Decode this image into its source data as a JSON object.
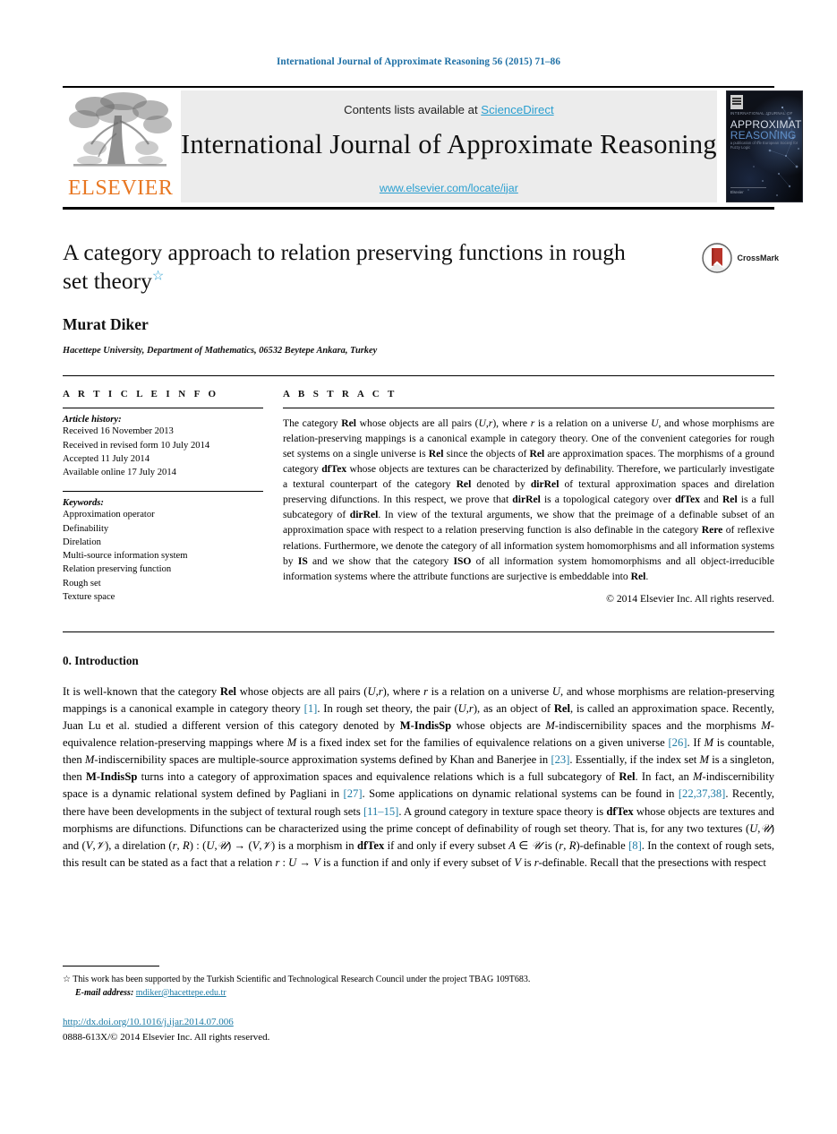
{
  "running_head": "International Journal of Approximate Reasoning 56 (2015) 71–86",
  "masthead": {
    "contents_prefix": "Contents lists available at ",
    "sciencedirect": "ScienceDirect",
    "journal_title": "International Journal of Approximate Reasoning",
    "journal_url": "www.elsevier.com/locate/ijar",
    "publisher": "ELSEVIER",
    "cover": {
      "line_small": "INTERNATIONAL JOURNAL OF",
      "line1": "APPROXIMATE",
      "line2": "REASONING",
      "line3": "a publication of the European Society for Fuzzy Logic",
      "foot": "Elsevier"
    }
  },
  "article": {
    "title": "A category approach to relation preserving functions in rough set theory",
    "title_marker": "☆",
    "author": "Murat Diker",
    "affiliation": "Hacettepe University, Department of Mathematics, 06532 Beytepe Ankara, Turkey",
    "crossmark_label": "CrossMark"
  },
  "info": {
    "heading": "A R T I C L E   I N F O",
    "history_label": "Article history:",
    "history": [
      "Received 16 November 2013",
      "Received in revised form 10 July 2014",
      "Accepted 11 July 2014",
      "Available online 17 July 2014"
    ],
    "keywords_label": "Keywords:",
    "keywords": [
      "Approximation operator",
      "Definability",
      "Direlation",
      "Multi-source information system",
      "Relation preserving function",
      "Rough set",
      "Texture space"
    ]
  },
  "abstract": {
    "heading": "A B S T R A C T",
    "text_html": "The category <b>Rel</b> whose objects are all pairs (<i>U</i>,<i>r</i>), where <i>r</i> is a relation on a universe <i>U</i>, and whose morphisms are relation-preserving mappings is a canonical example in category theory. One of the convenient categories for rough set systems on a single universe is <b>Rel</b> since the objects of <b>Rel</b> are approximation spaces. The morphisms of a ground category <b>dfTex</b> whose objects are textures can be characterized by definability. Therefore, we particularly investigate a textural counterpart of the category <b>Rel</b> denoted by <b>dirRel</b> of textural approximation spaces and direlation preserving difunctions. In this respect, we prove that <b>dirRel</b> is a topological category over <b>dfTex</b> and <b>Rel</b> is a full subcategory of <b>dirRel</b>. In view of the textural arguments, we show that the preimage of a definable subset of an approximation space with respect to a relation preserving function is also definable in the category <b>Rere</b> of reflexive relations. Furthermore, we denote the category of all information system homomorphisms and all information systems by <b>IS</b> and we show that the category <b>ISO</b> of all information system homomorphisms and all object-irreducible information systems where the attribute functions are surjective is embeddable into <b>Rel</b>.",
    "copyright": "© 2014 Elsevier Inc. All rights reserved."
  },
  "section": {
    "number": "0.",
    "heading": "0.  Introduction",
    "paragraph_html": "It is well-known that the category <b>Rel</b> whose objects are all pairs (<i>U</i>,<i>r</i>), where <i>r</i> is a relation on a universe <i>U</i>, and whose morphisms are relation-preserving mappings is a canonical example in category theory <span class=\"ref\">[1]</span>. In rough set theory, the pair (<i>U</i>,<i>r</i>), as an object of <b>Rel</b>, is called an approximation space. Recently, Juan Lu et al. studied a different version of this category denoted by <b>M-IndisSp</b> whose objects are <i>M</i>-indiscernibility spaces and the morphisms <i>M</i>-equivalence relation-preserving mappings where <i>M</i> is a fixed index set for the families of equivalence relations on a given universe <span class=\"ref\">[26]</span>. If <i>M</i> is countable, then <i>M</i>-indiscernibility spaces are multiple-source approximation systems defined by Khan and Banerjee in <span class=\"ref\">[23]</span>. Essentially, if the index set <i>M</i> is a singleton, then <b>M-IndisSp</b> turns into a category of approximation spaces and equivalence relations which is a full subcategory of <b>Rel</b>. In fact, an <i>M</i>-indiscernibility space is a dynamic relational system defined by Pagliani in <span class=\"ref\">[27]</span>. Some applications on dynamic relational systems can be found in <span class=\"ref\">[22,37,38]</span>. Recently, there have been developments in the subject of textural rough sets <span class=\"ref\">[11–15]</span>. A ground category in texture space theory is <b>dfTex</b> whose objects are textures and morphisms are difunctions. Difunctions can be characterized using the prime concept of definability of rough set theory. That is, for any two textures (<i>U</i>,<i>𝒰</i>) and (<i>V</i>,<i>𝒱</i>), a direlation (<i>r</i>, <i>R</i>) : (<i>U</i>,<i>𝒰</i>) → (<i>V</i>,<i>𝒱</i>) is a morphism in <b>dfTex</b> if and only if every subset <i>A</i> ∈ <i>𝒰</i> is (<i>r</i>, <i>R</i>)-definable <span class=\"ref\">[8]</span>. In the context of rough sets, this result can be stated as a fact that a relation <i>r</i> : <i>U</i> → <i>V</i> is a function if and only if every subset of <i>V</i> is <i>r</i>-definable. Recall that the presections with respect"
  },
  "footer": {
    "star": "☆",
    "funding": "This work has been supported by the Turkish Scientific and Technological Research Council under the project TBAG 109T683.",
    "email_label": "E-mail address:",
    "email": "mdiker@hacettepe.edu.tr",
    "doi": "http://dx.doi.org/10.1016/j.ijar.2014.07.006",
    "issn_line": "0888-613X/© 2014 Elsevier Inc. All rights reserved."
  },
  "colors": {
    "link": "#1d7ba5",
    "sciencedirect": "#2a9fd0",
    "elsevier_orange": "#e87722",
    "running_head": "#1d6fa5"
  }
}
